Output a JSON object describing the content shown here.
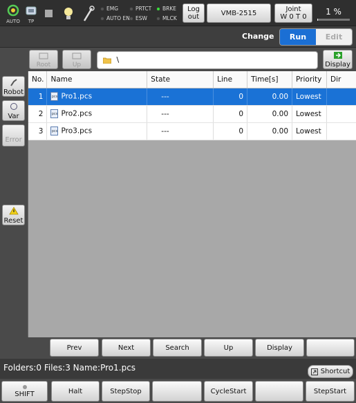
{
  "status_icons": {
    "auto_label": "AUTO",
    "tp_label": "TP"
  },
  "indicators": [
    {
      "label": "EMG",
      "on": false
    },
    {
      "label": "AUTO EN",
      "on": false
    },
    {
      "label": "PRTCT",
      "on": false
    },
    {
      "label": "ESW",
      "on": false
    },
    {
      "label": "BRKE",
      "on": true
    },
    {
      "label": "MLCK",
      "on": false
    }
  ],
  "topbar": {
    "logout_label_1": "Log",
    "logout_label_2": "out",
    "robot_model": "VMB-2515",
    "joint_label": "Joint",
    "joint_value": "W 0 T 0",
    "speed": "1 %",
    "speed_fraction": 0.01
  },
  "mode": {
    "change_label": "Change",
    "run_label": "Run",
    "edit_label": "Edit"
  },
  "toolbar": {
    "root_label": "Root",
    "up_label": "Up",
    "path": "\\",
    "display_label": "Display"
  },
  "side": {
    "robot_label": "Robot",
    "var_label": "Var",
    "error_label": "Error",
    "reset_label": "Reset"
  },
  "table": {
    "headers": [
      "No.",
      "Name",
      "State",
      "Line",
      "Time[s]",
      "Priority",
      "Dir"
    ],
    "rows": [
      {
        "no": "1",
        "name": "Pro1.pcs",
        "state": "---",
        "line": "0",
        "time": "0.00",
        "priority": "Lowest",
        "dir": ""
      },
      {
        "no": "2",
        "name": "Pro2.pcs",
        "state": "---",
        "line": "0",
        "time": "0.00",
        "priority": "Lowest",
        "dir": ""
      },
      {
        "no": "3",
        "name": "Pro3.pcs",
        "state": "---",
        "line": "0",
        "time": "0.00",
        "priority": "Lowest",
        "dir": ""
      }
    ]
  },
  "nav_buttons": {
    "prev": "Prev",
    "next": "Next",
    "search": "Search",
    "up": "Up",
    "display": "Display"
  },
  "status": {
    "text": "Folders:0  Files:3  Name:Pro1.pcs",
    "shortcut_label": "Shortcut"
  },
  "bottom_buttons": {
    "shift": "SHIFT",
    "halt": "Halt",
    "stepstop": "StepStop",
    "cyclestart": "CycleStart",
    "stepstart": "StepStart"
  },
  "colors": {
    "selected_row": "#1a72d6",
    "run_active": "#1b6fd4",
    "brake_on": "#3be03b"
  }
}
